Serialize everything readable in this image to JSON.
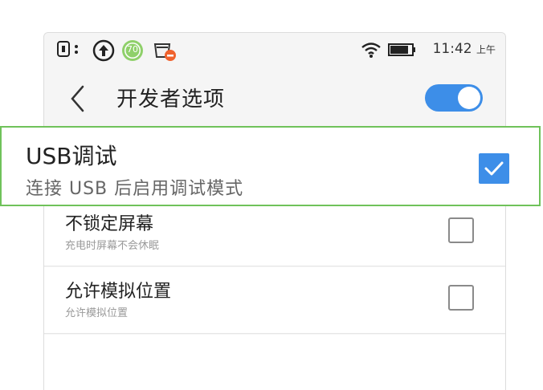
{
  "status_bar": {
    "time": "11:42",
    "ampm": "上午",
    "notification_badge": "70"
  },
  "header": {
    "title": "开发者选项",
    "toggle_on": true
  },
  "highlighted_item": {
    "title": "USB调试",
    "subtitle": "连接 USB 后启用调试模式",
    "checked": true
  },
  "items": [
    {
      "title": "不锁定屏幕",
      "subtitle": "充电时屏幕不会休眠",
      "checked": false
    },
    {
      "title": "允许模拟位置",
      "subtitle": "允许模拟位置",
      "checked": false
    }
  ],
  "colors": {
    "accent": "#3d8ee8",
    "highlight_border": "#6fc25a"
  }
}
